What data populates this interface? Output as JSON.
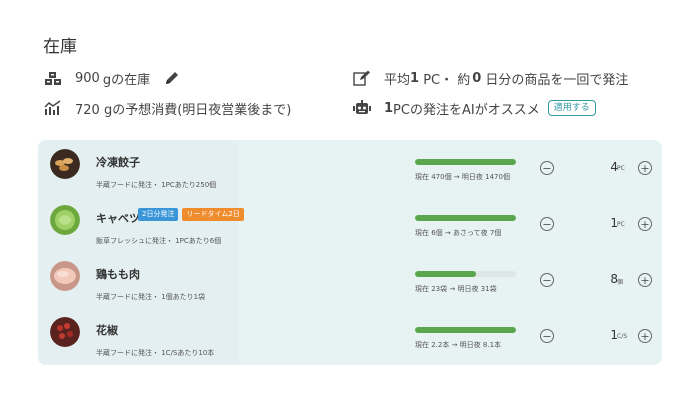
{
  "page": {
    "title": "在庫"
  },
  "stats": {
    "stock": {
      "amount": "900",
      "unit_text": " gの在庫",
      "icon": "boxes-icon",
      "edit_icon": "pencil-icon"
    },
    "forecast": {
      "text": "720 gの予想消費(明日夜営業後まで)",
      "icon": "chart-icon"
    },
    "average": {
      "prefix": "平均",
      "pc": "1",
      "mid": " PC・ 約",
      "days": "0",
      "suffix": " 日分の商品を一回で発注",
      "icon": "edit-icon"
    },
    "ai": {
      "prefix": "1",
      "text": "PCの発注をAIがオススメ",
      "apply_label": "適用する",
      "icon": "robot-icon"
    }
  },
  "products": [
    {
      "name": "冷凍餃子",
      "tags": [],
      "desc": "半蔵フードに発注・ 1PCあたり250個",
      "progress": 1.0,
      "progress_text": "現在 470個 → 明日夜 1470個",
      "qty": "4",
      "unit": "PC"
    },
    {
      "name": "キャベツ",
      "tags": [
        {
          "label": "2日分発注",
          "color": "blue"
        },
        {
          "label": "リードタイム2日",
          "color": "orange"
        }
      ],
      "desc": "飯草フレッシュに発注・ 1PCあたり6個",
      "progress": 1.0,
      "progress_text": "現在 6個 → あさって夜 7個",
      "qty": "1",
      "unit": "PC"
    },
    {
      "name": "鶏もも肉",
      "tags": [],
      "desc": "半蔵フードに発注・ 1個あたり1袋",
      "progress": 0.6,
      "progress_text": "現在 23袋 → 明日夜 31袋",
      "qty": "8",
      "unit": "個"
    },
    {
      "name": "花椒",
      "tags": [],
      "desc": "半蔵フードに発注・ 1C/Sあたり10本",
      "progress": 1.0,
      "progress_text": "現在 2.2本 → 明日夜 8.1本",
      "qty": "1",
      "unit": "C/S"
    }
  ],
  "colors": {
    "accent": "#2f9aa6",
    "progress": "#5aa64a",
    "panel": "#e7f2f3",
    "tag_blue": "#3a96d8",
    "tag_orange": "#ef8c2e"
  }
}
